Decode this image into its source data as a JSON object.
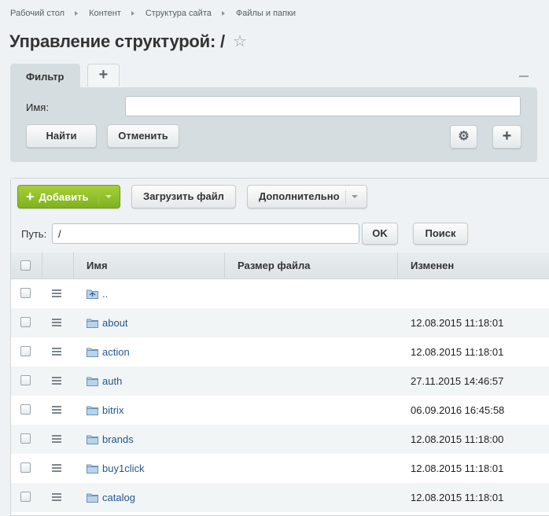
{
  "breadcrumb": [
    "Рабочий стол",
    "Контент",
    "Структура сайта",
    "Файлы и папки"
  ],
  "page": {
    "title": "Управление структурой: /"
  },
  "filter": {
    "tab_label": "Фильтр",
    "name_label": "Имя:",
    "name_value": "",
    "find_label": "Найти",
    "cancel_label": "Отменить"
  },
  "toolbar": {
    "add_label": "Добавить",
    "upload_label": "Загрузить файл",
    "more_label": "Дополнительно",
    "path_label": "Путь:",
    "path_value": "/",
    "ok_label": "OK",
    "search_label": "Поиск"
  },
  "table": {
    "columns": [
      "Имя",
      "Размер файла",
      "Изменен"
    ],
    "rows": [
      {
        "name": "..",
        "size": "",
        "modified": "",
        "type": "up-folder-icon"
      },
      {
        "name": "about",
        "size": "",
        "modified": "12.08.2015 11:18:01",
        "type": "folder-icon"
      },
      {
        "name": "action",
        "size": "",
        "modified": "12.08.2015 11:18:01",
        "type": "folder-icon"
      },
      {
        "name": "auth",
        "size": "",
        "modified": "27.11.2015 14:46:57",
        "type": "folder-icon"
      },
      {
        "name": "bitrix",
        "size": "",
        "modified": "06.09.2016 16:45:58",
        "type": "folder-icon"
      },
      {
        "name": "brands",
        "size": "",
        "modified": "12.08.2015 11:18:00",
        "type": "folder-icon"
      },
      {
        "name": "buy1click",
        "size": "",
        "modified": "12.08.2015 11:18:01",
        "type": "folder-icon"
      },
      {
        "name": "catalog",
        "size": "",
        "modified": "12.08.2015 11:18:01",
        "type": "folder-icon"
      }
    ]
  },
  "colors": {
    "accent_green": "#8bbc28",
    "link_blue": "#24588f",
    "panel_gray": "#d6dde1"
  }
}
